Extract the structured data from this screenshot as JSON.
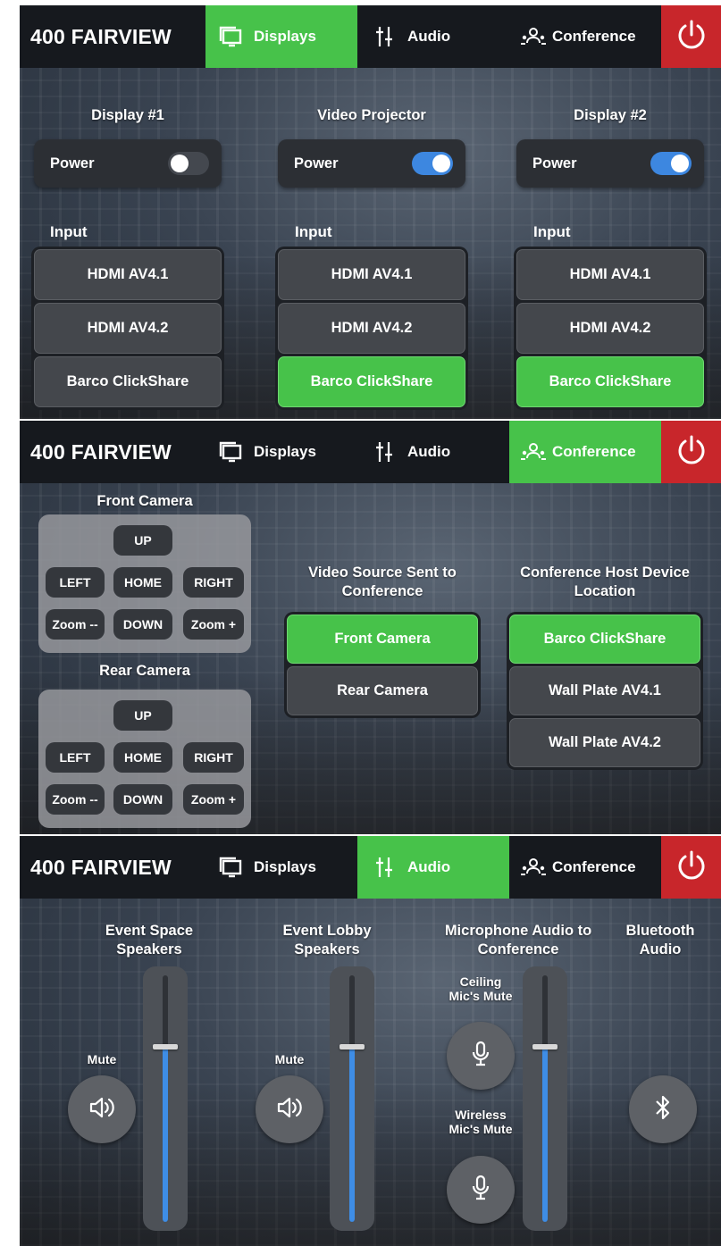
{
  "app": {
    "brand": "400 FAIRVIEW",
    "tabs": {
      "displays": "Displays",
      "audio": "Audio",
      "conference": "Conference"
    },
    "colors": {
      "active_tab": "#47c24a",
      "power": "#c8262b",
      "toggle_on": "#3d87e0",
      "fader": "#3e8de6"
    }
  },
  "displays_page": {
    "active_tab": "displays",
    "power_label": "Power",
    "input_label": "Input",
    "displays": [
      {
        "title": "Display #1",
        "power_on": false,
        "inputs": [
          "HDMI  AV4.1",
          "HDMI  AV4.2",
          "Barco ClickShare"
        ],
        "selected": 2,
        "selected_shown": false
      },
      {
        "title": "Video Projector",
        "power_on": true,
        "inputs": [
          "HDMI  AV4.1",
          "HDMI  AV4.2",
          "Barco ClickShare"
        ],
        "selected": 2,
        "selected_shown": true
      },
      {
        "title": "Display #2",
        "power_on": true,
        "inputs": [
          "HDMI  AV4.1",
          "HDMI  AV4.2",
          "Barco ClickShare"
        ],
        "selected": 2,
        "selected_shown": true
      }
    ]
  },
  "conference_page": {
    "active_tab": "conference",
    "front_camera": {
      "title": "Front Camera"
    },
    "rear_camera": {
      "title": "Rear Camera"
    },
    "ptz": {
      "up": "UP",
      "left": "LEFT",
      "home": "HOME",
      "right": "RIGHT",
      "zoom_out": "Zoom --",
      "down": "DOWN",
      "zoom_in": "Zoom +"
    },
    "video_source": {
      "title": "Video Source Sent to Conference",
      "options": [
        "Front Camera",
        "Rear Camera"
      ],
      "selected": 0
    },
    "host_location": {
      "title": "Conference Host Device Location",
      "options": [
        "Barco ClickShare",
        "Wall Plate  AV4.1",
        "Wall Plate  AV4.2"
      ],
      "selected": 0
    }
  },
  "audio_page": {
    "active_tab": "audio",
    "event_space": {
      "title": "Event Space Speakers",
      "mute_label": "Mute",
      "level": 0.71
    },
    "event_lobby": {
      "title": "Event Lobby Speakers",
      "mute_label": "Mute",
      "level": 0.71
    },
    "mic_audio": {
      "title": "Microphone Audio to Conference",
      "ceiling_label": "Ceiling Mic's Mute",
      "wireless_label": "Wireless Mic's Mute",
      "level": 0.71
    },
    "bluetooth": {
      "title": "Bluetooth Audio"
    }
  }
}
